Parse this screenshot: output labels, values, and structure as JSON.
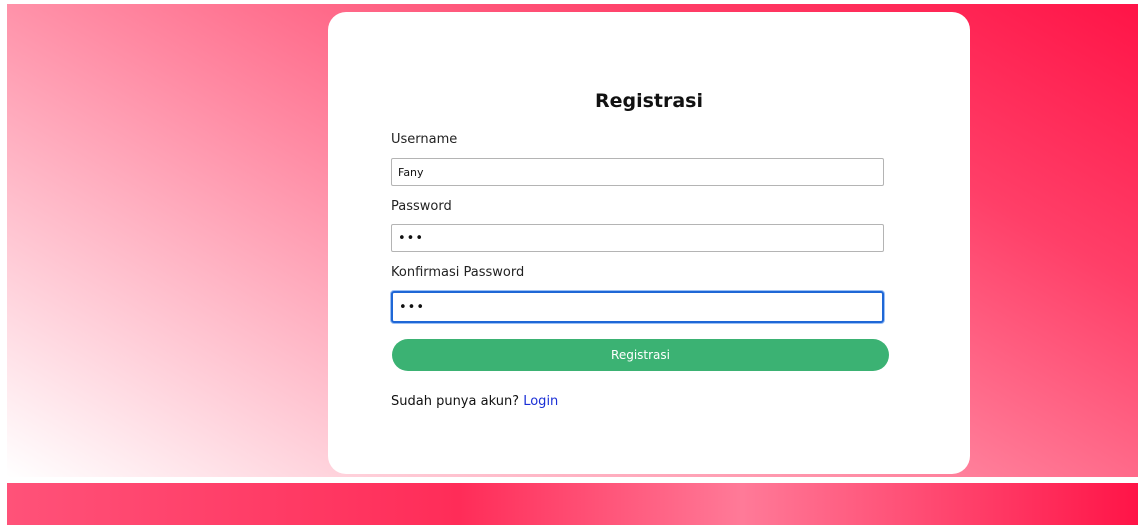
{
  "form": {
    "title": "Registrasi",
    "username": {
      "label": "Username",
      "value": "Fany"
    },
    "password": {
      "label": "Password",
      "masked_value": "•••"
    },
    "confirm_password": {
      "label": "Konfirmasi Password",
      "masked_value": "•••"
    },
    "submit_label": "Registrasi",
    "login_prompt": "Sudah punya akun?",
    "login_link": "Login"
  }
}
